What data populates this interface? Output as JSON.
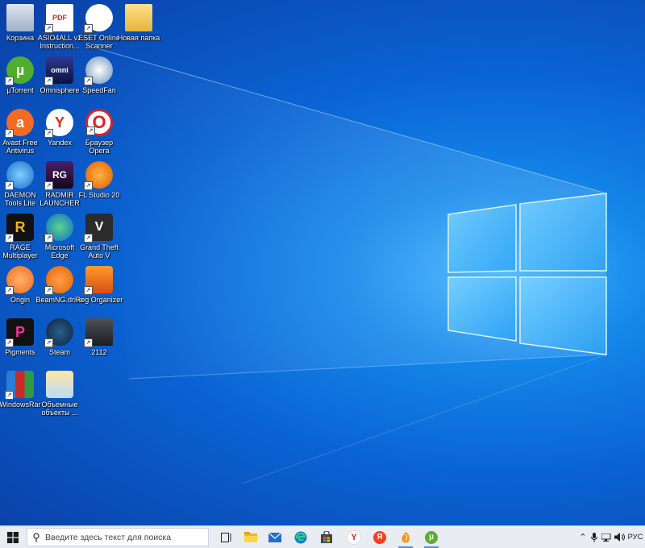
{
  "desktop": {
    "icons": [
      {
        "label": "Корзина",
        "icon": "recycle-bin-icon"
      },
      {
        "label": "ASIO4ALL v2 Instruction...",
        "icon": "pdf-icon",
        "badge": "PDF"
      },
      {
        "label": "ESET Online Scanner",
        "icon": "eset-icon"
      },
      {
        "label": "Новая папка",
        "icon": "folder-icon"
      },
      {
        "label": "µTorrent",
        "icon": "utorrent-icon",
        "badge": "µ"
      },
      {
        "label": "Omnisphere",
        "icon": "omnisphere-icon",
        "badge": "omni"
      },
      {
        "label": "SpeedFan",
        "icon": "speedfan-icon"
      },
      {
        "label": "Avast Free Antivirus",
        "icon": "avast-icon",
        "badge": "a"
      },
      {
        "label": "Yandex",
        "icon": "yandex-browser-icon",
        "badge": "Y"
      },
      {
        "label": "Браузер Opera",
        "icon": "opera-icon",
        "badge": "O"
      },
      {
        "label": "DAEMON Tools Lite",
        "icon": "daemon-tools-icon"
      },
      {
        "label": "RADMIR LAUNCHER",
        "icon": "radmir-icon",
        "badge": "RG"
      },
      {
        "label": "FL Studio 20",
        "icon": "fl-studio-icon"
      },
      {
        "label": "RAGE Multiplayer",
        "icon": "rage-icon",
        "badge": "R"
      },
      {
        "label": "Microsoft Edge",
        "icon": "edge-icon"
      },
      {
        "label": "Grand Theft Auto V",
        "icon": "gta-icon",
        "badge": "V"
      },
      {
        "label": "Origin",
        "icon": "origin-icon"
      },
      {
        "label": "BeamNG.drive",
        "icon": "beamng-icon"
      },
      {
        "label": "Reg Organizer",
        "icon": "reg-organizer-icon"
      },
      {
        "label": "Pigments",
        "icon": "pigments-icon",
        "badge": "P"
      },
      {
        "label": "Steam",
        "icon": "steam-icon"
      },
      {
        "label": "2112",
        "icon": "image-file-icon"
      },
      {
        "label": "WindowsRar",
        "icon": "winrar-icon"
      },
      {
        "label": "Объемные объекты ...",
        "icon": "3d-objects-icon"
      }
    ]
  },
  "taskbar": {
    "search_placeholder": "Введите здесь текст для поиска",
    "pinned": [
      {
        "name": "task-view-icon"
      },
      {
        "name": "file-explorer-icon"
      },
      {
        "name": "mail-icon"
      },
      {
        "name": "edge-icon"
      },
      {
        "name": "store-icon"
      },
      {
        "name": "yandex-browser-icon",
        "glyph": "Y"
      },
      {
        "name": "yandex-icon",
        "glyph": "Я"
      },
      {
        "name": "fl-studio-icon"
      },
      {
        "name": "utorrent-icon",
        "glyph": "µ"
      }
    ],
    "tray": {
      "language": "РУС"
    }
  },
  "colors": {
    "desktop_blue": "#0a63d3",
    "light_blue": "#3fb4ff",
    "taskbar": "#e9ecf1"
  }
}
